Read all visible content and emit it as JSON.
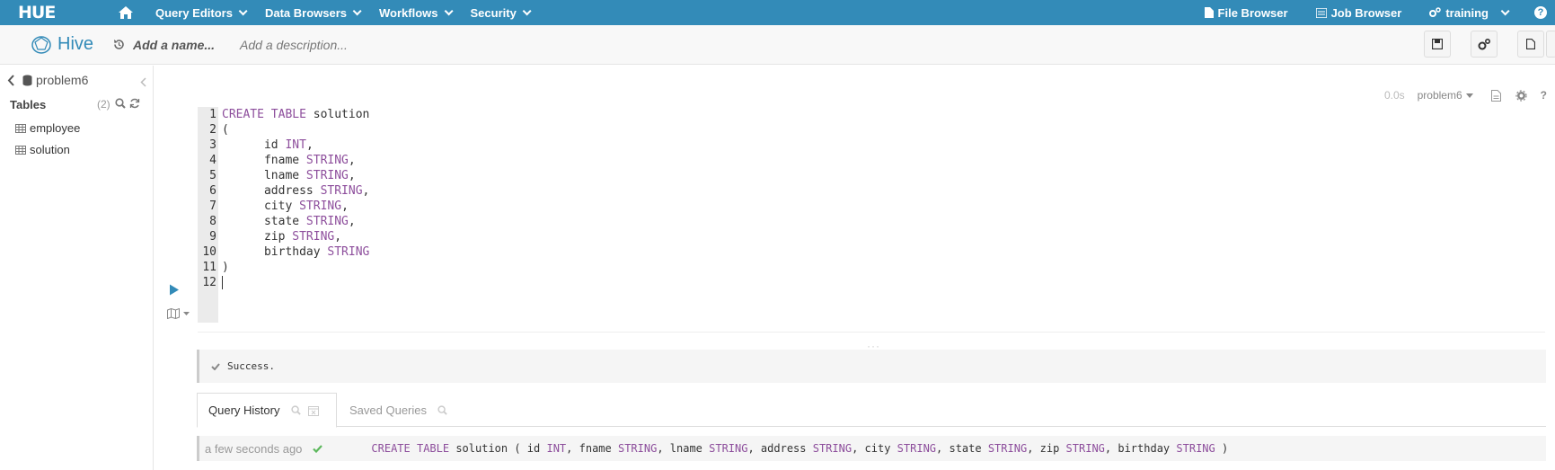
{
  "nav": {
    "logo": "HUE",
    "menus": [
      "Query Editors",
      "Data Browsers",
      "Workflows",
      "Security"
    ],
    "file_browser": "File Browser",
    "job_browser": "Job Browser",
    "user": "training",
    "help": "?"
  },
  "editor": {
    "title": "Hive",
    "name_placeholder": "Add a name...",
    "description_placeholder": "Add a description..."
  },
  "sidebar": {
    "database": "problem6",
    "tables_label": "Tables",
    "table_count": "(2)",
    "tables": [
      "employee",
      "solution"
    ]
  },
  "snippet": {
    "duration": "0.0s",
    "database": "problem6"
  },
  "code": {
    "lines": [
      [
        {
          "t": "CREATE TABLE",
          "k": true
        },
        {
          "t": " solution"
        }
      ],
      [
        {
          "t": "("
        }
      ],
      [
        {
          "t": "      id "
        },
        {
          "t": "INT",
          "k": true
        },
        {
          "t": ","
        }
      ],
      [
        {
          "t": "      fname "
        },
        {
          "t": "STRING",
          "k": true
        },
        {
          "t": ","
        }
      ],
      [
        {
          "t": "      lname "
        },
        {
          "t": "STRING",
          "k": true
        },
        {
          "t": ","
        }
      ],
      [
        {
          "t": "      address "
        },
        {
          "t": "STRING",
          "k": true
        },
        {
          "t": ","
        }
      ],
      [
        {
          "t": "      city "
        },
        {
          "t": "STRING",
          "k": true
        },
        {
          "t": ","
        }
      ],
      [
        {
          "t": "      state "
        },
        {
          "t": "STRING",
          "k": true
        },
        {
          "t": ","
        }
      ],
      [
        {
          "t": "      zip "
        },
        {
          "t": "STRING",
          "k": true
        },
        {
          "t": ","
        }
      ],
      [
        {
          "t": "      birthday "
        },
        {
          "t": "STRING",
          "k": true
        }
      ],
      [
        {
          "t": ")"
        }
      ],
      []
    ]
  },
  "result": {
    "message": "Success."
  },
  "tabs": {
    "history": "Query History",
    "saved": "Saved Queries"
  },
  "history": {
    "time": "a few seconds ago",
    "query_parts": [
      {
        "t": "CREATE TABLE",
        "k": true
      },
      {
        "t": " solution ( id "
      },
      {
        "t": "INT",
        "k": true
      },
      {
        "t": ", fname "
      },
      {
        "t": "STRING",
        "k": true
      },
      {
        "t": ", lname "
      },
      {
        "t": "STRING",
        "k": true
      },
      {
        "t": ", address "
      },
      {
        "t": "STRING",
        "k": true
      },
      {
        "t": ", city "
      },
      {
        "t": "STRING",
        "k": true
      },
      {
        "t": ", state "
      },
      {
        "t": "STRING",
        "k": true
      },
      {
        "t": ", zip "
      },
      {
        "t": "STRING",
        "k": true
      },
      {
        "t": ", birthday "
      },
      {
        "t": "STRING",
        "k": true
      },
      {
        "t": " )"
      }
    ]
  },
  "colors": {
    "brand": "#338bb8",
    "keyword": "#8d4e9c",
    "success": "#5cb85c"
  }
}
